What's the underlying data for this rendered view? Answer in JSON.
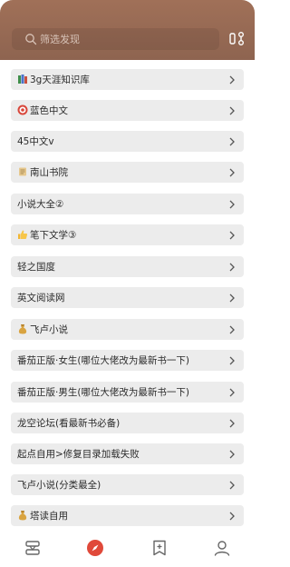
{
  "search": {
    "placeholder": "筛选发现"
  },
  "items": [
    {
      "label": "3g天涯知识库",
      "icon": "books-emoji-icon"
    },
    {
      "label": "蓝色中文",
      "icon": "target-emoji-icon"
    },
    {
      "label": "45中文v",
      "icon": ""
    },
    {
      "label": "南山书院",
      "icon": "scroll-emoji-icon"
    },
    {
      "label": "小说大全②",
      "icon": ""
    },
    {
      "label": "笔下文学③",
      "icon": "thumbs-up-emoji-icon"
    },
    {
      "label": "轻之国度",
      "icon": ""
    },
    {
      "label": "英文阅读网",
      "icon": ""
    },
    {
      "label": "飞卢小说",
      "icon": "money-bag-emoji-icon"
    },
    {
      "label": "番茄正版·女生(哪位大佬改为最新书一下)",
      "icon": ""
    },
    {
      "label": "番茄正版·男生(哪位大佬改为最新书一下)",
      "icon": ""
    },
    {
      "label": "龙空论坛(看最新书必备)",
      "icon": ""
    },
    {
      "label": "起点自用>修复目录加载失败",
      "icon": ""
    },
    {
      "label": "飞卢小说(分类最全)",
      "icon": ""
    },
    {
      "label": "塔读自用",
      "icon": "money-bag-emoji-icon"
    }
  ],
  "colors": {
    "accent": "#e0493a",
    "header": "#996b55"
  },
  "nav": [
    "bookshelf-icon",
    "discover-icon",
    "bookmark-icon",
    "profile-icon"
  ]
}
